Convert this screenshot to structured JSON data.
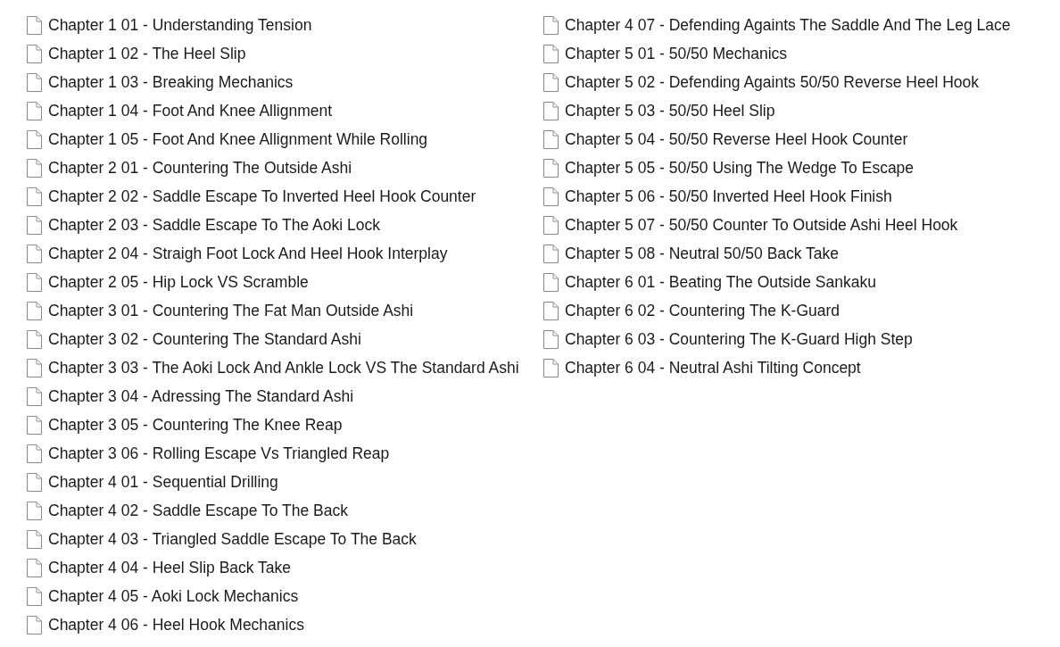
{
  "columns": [
    {
      "files": [
        {
          "name": "Chapter 1 01 - Understanding Tension"
        },
        {
          "name": "Chapter 1 02 - The Heel Slip"
        },
        {
          "name": "Chapter 1 03 - Breaking Mechanics"
        },
        {
          "name": "Chapter 1 04 - Foot And Knee Allignment"
        },
        {
          "name": "Chapter 1 05 - Foot And Knee Allignment While Rolling"
        },
        {
          "name": "Chapter 2 01 - Countering The Outside Ashi"
        },
        {
          "name": "Chapter 2 02 - Saddle Escape To Inverted Heel Hook Counter"
        },
        {
          "name": "Chapter 2 03 - Saddle Escape To The Aoki Lock"
        },
        {
          "name": "Chapter 2 04 - Straigh Foot Lock And Heel Hook Interplay"
        },
        {
          "name": "Chapter 2 05 - Hip Lock VS Scramble"
        },
        {
          "name": "Chapter 3 01 - Countering The Fat Man Outside Ashi"
        },
        {
          "name": "Chapter 3 02 - Countering The Standard Ashi"
        },
        {
          "name": "Chapter 3 03 - The Aoki Lock And Ankle Lock VS The Standard Ashi"
        },
        {
          "name": "Chapter 3 04 - Adressing The Standard Ashi"
        },
        {
          "name": "Chapter 3 05 - Countering The Knee Reap"
        },
        {
          "name": "Chapter 3 06 - Rolling Escape Vs Triangled Reap"
        },
        {
          "name": "Chapter 4 01 - Sequential Drilling"
        },
        {
          "name": "Chapter 4 02 - Saddle Escape To The Back"
        },
        {
          "name": "Chapter 4 03 - Triangled Saddle Escape To The Back"
        },
        {
          "name": "Chapter 4 04 - Heel Slip Back Take"
        },
        {
          "name": "Chapter 4 05 - Aoki Lock Mechanics"
        },
        {
          "name": "Chapter 4 06 - Heel Hook Mechanics"
        }
      ]
    },
    {
      "files": [
        {
          "name": "Chapter 4 07 - Defending Againts The Saddle And The Leg Lace"
        },
        {
          "name": "Chapter 5 01 - 50/50 Mechanics"
        },
        {
          "name": "Chapter 5 02 - Defending Againts 50/50 Reverse Heel Hook"
        },
        {
          "name": "Chapter 5 03 - 50/50 Heel Slip"
        },
        {
          "name": "Chapter 5 04 - 50/50 Reverse Heel Hook Counter"
        },
        {
          "name": "Chapter 5 05 - 50/50 Using The Wedge To Escape"
        },
        {
          "name": "Chapter 5 06 - 50/50 Inverted Heel Hook Finish"
        },
        {
          "name": "Chapter 5 07 - 50/50 Counter To Outside Ashi Heel Hook"
        },
        {
          "name": "Chapter 5 08 - Neutral 50/50 Back Take"
        },
        {
          "name": "Chapter 6 01 - Beating The Outside Sankaku"
        },
        {
          "name": "Chapter 6 02 - Countering The K-Guard"
        },
        {
          "name": "Chapter 6 03 - Countering The K-Guard High Step"
        },
        {
          "name": "Chapter 6 04 - Neutral Ashi Tilting Concept"
        }
      ]
    }
  ]
}
